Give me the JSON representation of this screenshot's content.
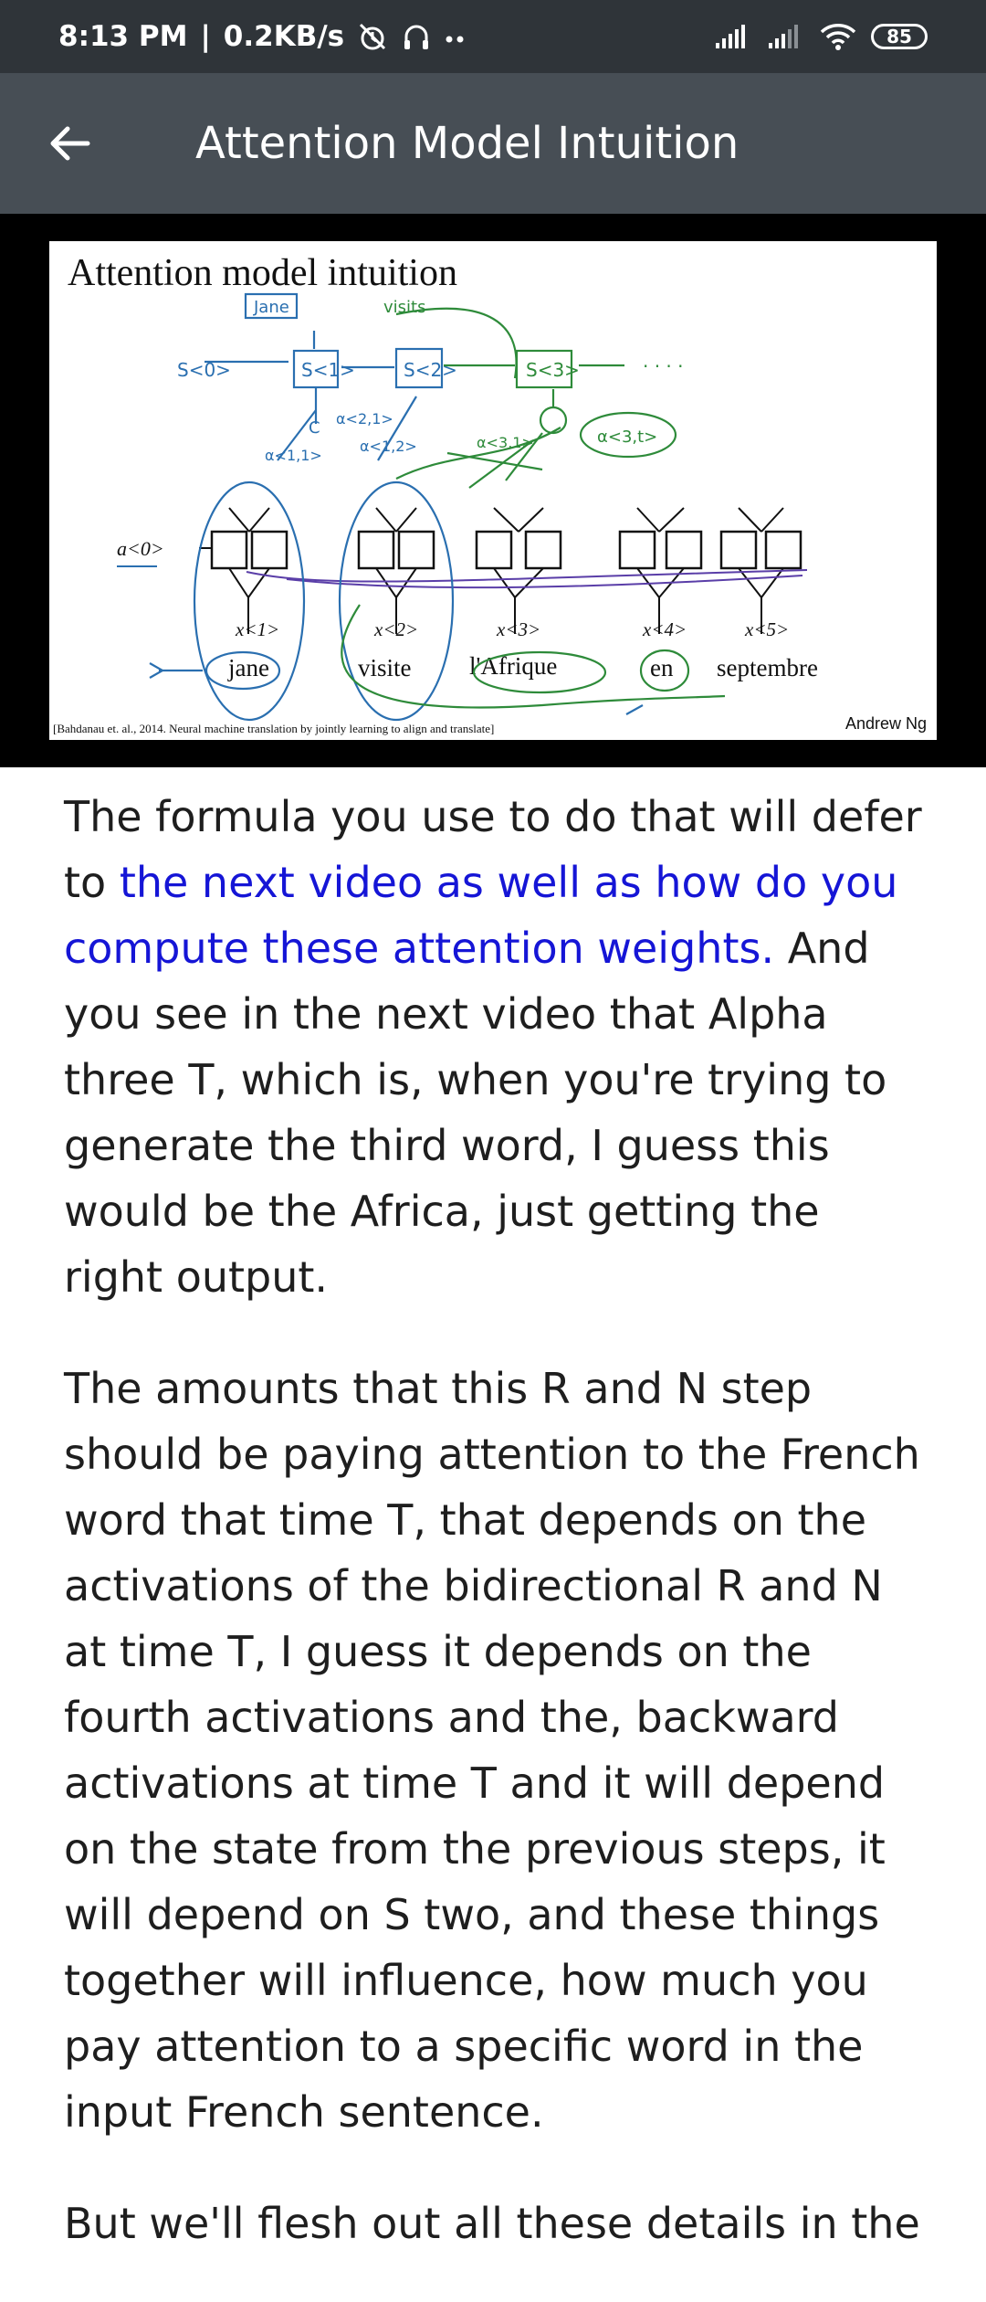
{
  "status_bar": {
    "time": "8:13 PM",
    "separator": "|",
    "net_speed": "0.2KB/s",
    "battery": "85",
    "icons": [
      "alarm-off-icon",
      "headphones-icon",
      "more-dots-icon",
      "signal-icon",
      "signal-icon",
      "wifi-icon",
      "battery-icon"
    ]
  },
  "app_bar": {
    "back_icon": "arrow-left-icon",
    "title": "Attention Model Intuition"
  },
  "slide": {
    "title": "Attention model intuition",
    "a0": "a<0>",
    "words": [
      "jane",
      "visite",
      "l'Afrique",
      "en",
      "septembre"
    ],
    "x_labels": [
      "x<1>",
      "x<2>",
      "x<3>",
      "x<4>",
      "x<5>"
    ],
    "citation": "[Bahdanau et. al., 2014. Neural machine translation by jointly learning to align and translate]",
    "credit": "Andrew Ng",
    "handwritten": {
      "jane": "Jane",
      "visits": "visits",
      "s0": "S<0>",
      "s1": "S<1>",
      "s2": "S<2>",
      "s3": "S<3>",
      "c": "C",
      "a11": "α<1,1>",
      "a12": "α<1,2>",
      "a21": "α<2,1>",
      "a31": "α<3,1>",
      "a3t": "α<3,t>",
      "dots": "· · · ·"
    },
    "colors": {
      "blue_ink": "#2a6fb0",
      "green_ink": "#2e8b3a",
      "purple_ink": "#5a3ea8"
    }
  },
  "article": {
    "p1_start": "The formula you use to do that will defer to ",
    "p1_link": "the next video as well as how do you compute these attention weights.",
    "p1_end": " And you see in the next video that Alpha three T, which is, when you're trying to generate the third word, I guess this would be the Africa, just getting the right output.",
    "p2": "The amounts that this R and N step should be paying attention to the French word that time T, that depends on the activations of the bidirectional R and N at time T, I guess it depends on the fourth activations and the, backward activations at time T and it will depend on the state from the previous steps, it will depend on S two, and these things together will influence, how much you pay attention to a specific word in the input French sentence.",
    "p3": "But we'll flesh out all these details in the",
    "link_color": "#1515d6"
  }
}
